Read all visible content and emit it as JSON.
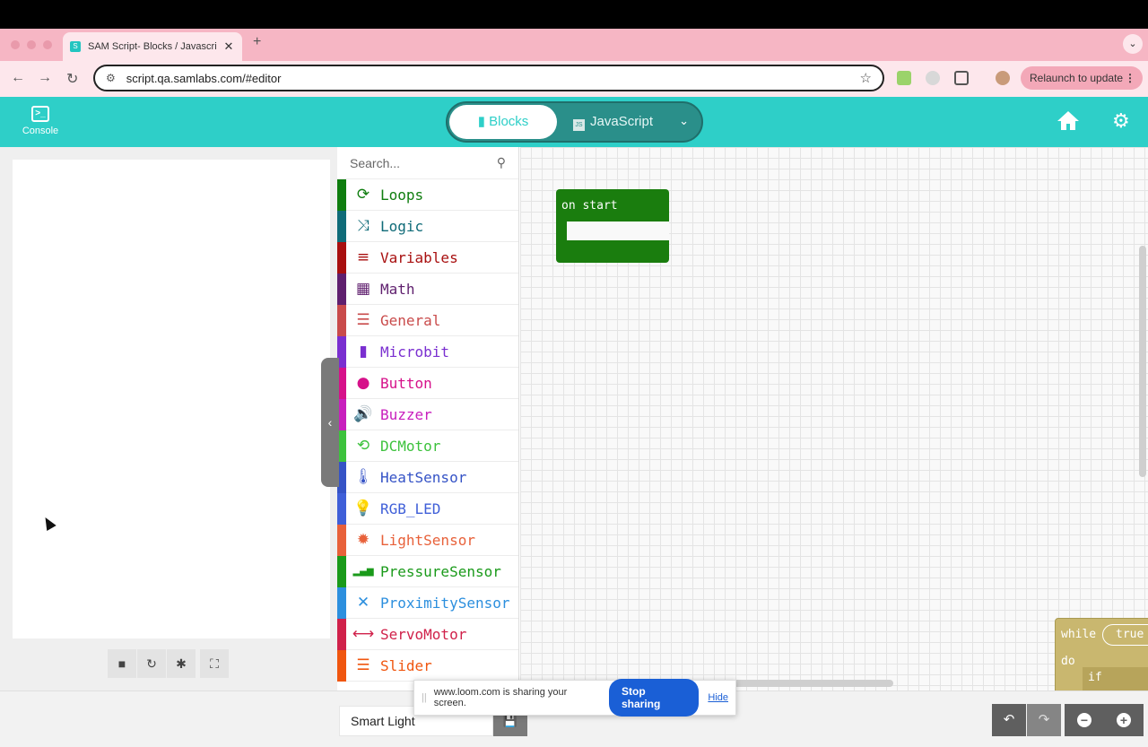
{
  "browser": {
    "tab_title": "SAM Script- Blocks / Javascri",
    "tab_close": "✕",
    "new_tab": "+",
    "url": "script.qa.samlabs.com/#editor",
    "relaunch_label": "Relaunch to update"
  },
  "header": {
    "console_label": "Console",
    "blocks_label": "Blocks",
    "javascript_label": "JavaScript"
  },
  "toolbox": {
    "search_placeholder": "Search...",
    "categories": [
      {
        "label": "Loops",
        "color": "#0f7d0f",
        "icon": "loop-icon"
      },
      {
        "label": "Logic",
        "color": "#0f6b78",
        "icon": "shuffle-icon"
      },
      {
        "label": "Variables",
        "color": "#a80f0f",
        "icon": "list-lines-icon"
      },
      {
        "label": "Math",
        "color": "#5f1f6e",
        "icon": "calculator-icon"
      },
      {
        "label": "General",
        "color": "#c94b4b",
        "icon": "list-icon"
      },
      {
        "label": "Microbit",
        "color": "#7a2fd0",
        "icon": "chip-icon"
      },
      {
        "label": "Button",
        "color": "#d6118a",
        "icon": "circle-icon"
      },
      {
        "label": "Buzzer",
        "color": "#c81fbd",
        "icon": "speaker-icon"
      },
      {
        "label": "DCMotor",
        "color": "#3dc23d",
        "icon": "refresh-icon"
      },
      {
        "label": "HeatSensor",
        "color": "#3553c6",
        "icon": "thermometer-icon"
      },
      {
        "label": "RGB_LED",
        "color": "#3f5fd8",
        "icon": "bulb-icon"
      },
      {
        "label": "LightSensor",
        "color": "#e8613a",
        "icon": "sun-icon"
      },
      {
        "label": "PressureSensor",
        "color": "#1a9a1a",
        "icon": "signal-bars-icon"
      },
      {
        "label": "ProximitySensor",
        "color": "#2c8fde",
        "icon": "expand-arrows-icon"
      },
      {
        "label": "ServoMotor",
        "color": "#d0214a",
        "icon": "horizontal-arrows-icon"
      },
      {
        "label": "Slider",
        "color": "#f0560f",
        "icon": "sliders-icon"
      }
    ]
  },
  "workspace": {
    "on_start_label": "on start",
    "while_label": "while",
    "true_label": "true",
    "do_label": "do",
    "if_label": "if"
  },
  "footer": {
    "project_name": "Smart Light"
  },
  "loom": {
    "message": "www.loom.com is sharing your screen.",
    "stop_label": "Stop sharing",
    "hide_label": "Hide"
  }
}
